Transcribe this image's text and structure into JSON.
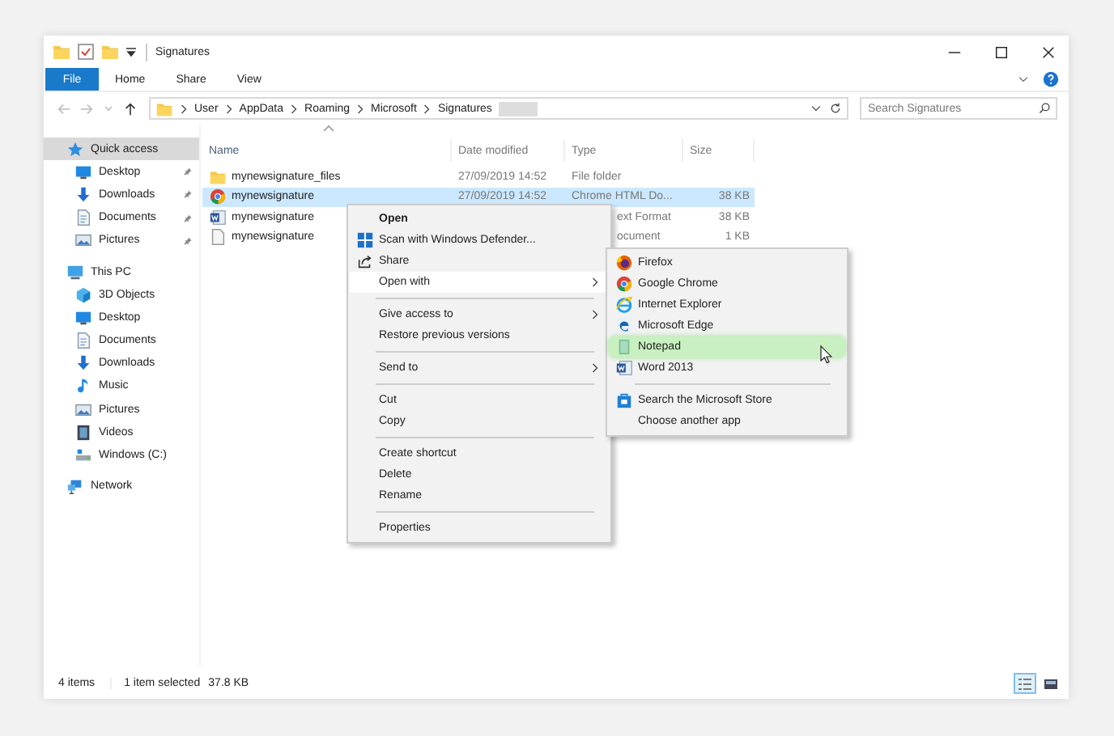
{
  "window": {
    "title": "Signatures"
  },
  "ribbon": {
    "file_button": "File",
    "tabs": [
      "Home",
      "Share",
      "View"
    ]
  },
  "address": {
    "crumbs": [
      "User",
      "AppData",
      "Roaming",
      "Microsoft",
      "Signatures"
    ]
  },
  "search": {
    "placeholder": "Search Signatures"
  },
  "nav": [
    {
      "label": "Quick access",
      "kind": "star",
      "selected": true,
      "children": [
        {
          "label": "Desktop",
          "kind": "desktop",
          "pinned": true,
          "selected": false
        },
        {
          "label": "Downloads",
          "kind": "download",
          "pinned": true,
          "selected": false
        },
        {
          "label": "Documents",
          "kind": "document",
          "pinned": true,
          "selected": false
        },
        {
          "label": "Pictures",
          "kind": "pictures",
          "pinned": true,
          "selected": false
        }
      ]
    },
    {
      "label": "This PC",
      "kind": "pc",
      "selected": false,
      "children": [
        {
          "label": "3D Objects",
          "kind": "cube",
          "selected": false
        },
        {
          "label": "Desktop",
          "kind": "desktop",
          "selected": false
        },
        {
          "label": "Documents",
          "kind": "document",
          "selected": false
        },
        {
          "label": "Downloads",
          "kind": "download",
          "selected": false
        },
        {
          "label": "Music",
          "kind": "music",
          "selected": false
        },
        {
          "label": "Pictures",
          "kind": "pictures",
          "selected": false
        },
        {
          "label": "Videos",
          "kind": "videos",
          "selected": false
        },
        {
          "label": "Windows (C:)",
          "kind": "drive",
          "selected": false
        }
      ]
    },
    {
      "label": "Network",
      "kind": "network",
      "selected": false
    }
  ],
  "files": {
    "columns": [
      "Name",
      "Date modified",
      "Type",
      "Size"
    ],
    "rows": [
      {
        "name": "mynewsignature_files",
        "kind": "folder",
        "date": "27/09/2019 14:52",
        "type": "File folder",
        "selected": false
      },
      {
        "name": "mynewsignature",
        "kind": "chrome",
        "date": "27/09/2019 14:52",
        "type": "Chrome HTML Do...",
        "size": "38 KB",
        "selected": true
      },
      {
        "name": "mynewsignature",
        "kind": "word",
        "type": "ext Format",
        "size": "38 KB",
        "selected": false
      },
      {
        "name": "mynewsignature",
        "kind": "text",
        "type": "ocument",
        "size": "1 KB",
        "selected": false
      }
    ]
  },
  "context_menu": [
    [
      {
        "label": "Open",
        "default": true
      },
      {
        "label": "Scan with Windows Defender...",
        "kind": "defender"
      },
      {
        "label": "Share",
        "kind": "share"
      },
      {
        "label": "Open with",
        "submenu": true,
        "selected": true
      }
    ],
    [
      {
        "label": "Give access to",
        "submenu": true
      },
      {
        "label": "Restore previous versions"
      }
    ],
    [
      {
        "label": "Send to",
        "submenu": true
      }
    ],
    [
      {
        "label": "Cut"
      },
      {
        "label": "Copy"
      }
    ],
    [
      {
        "label": "Create shortcut"
      },
      {
        "label": "Delete"
      },
      {
        "label": "Rename"
      }
    ],
    [
      {
        "label": "Properties"
      }
    ]
  ],
  "open_with": [
    [
      {
        "label": "Firefox",
        "kind": "firefox",
        "selected": false
      },
      {
        "label": "Google Chrome",
        "kind": "chrome",
        "selected": false
      },
      {
        "label": "Internet Explorer",
        "kind": "ie",
        "selected": false
      },
      {
        "label": "Microsoft Edge",
        "kind": "edge",
        "selected": false
      },
      {
        "label": "Notepad",
        "kind": "notepad",
        "selected": true
      },
      {
        "label": "Word 2013",
        "kind": "word",
        "selected": false
      }
    ],
    [
      {
        "label": "Search the Microsoft Store",
        "kind": "store",
        "selected": false
      },
      {
        "label": "Choose another app",
        "selected": false
      }
    ]
  ],
  "status_bar": {
    "count": "4 items",
    "selection": "1 item selected",
    "size": "37.8 KB"
  },
  "view_buttons": [
    {
      "kind": "details",
      "selected": true
    },
    {
      "kind": "tiles",
      "selected": false
    }
  ]
}
